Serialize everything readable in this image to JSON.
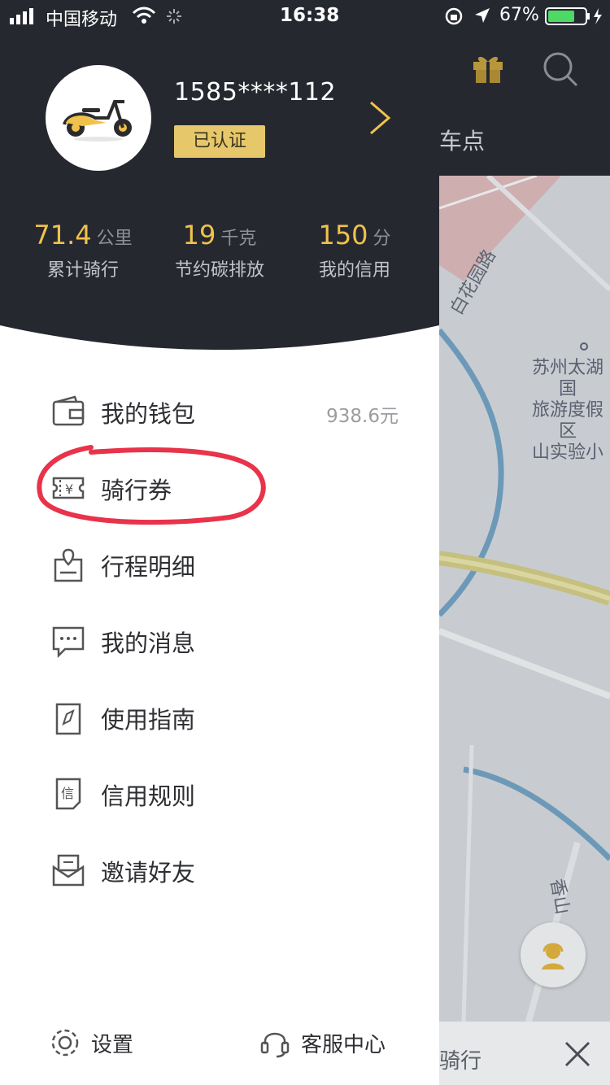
{
  "status_bar": {
    "carrier": "中国移动",
    "time": "16:38",
    "battery": "67%"
  },
  "map": {
    "top_label": "车点",
    "poi": [
      "苏州太湖国",
      "旅游度假区",
      "山实验小"
    ],
    "road_label_1": "白花园路",
    "road_label_2": "香山",
    "bottom_text": "骑行"
  },
  "profile": {
    "phone": "1585****112",
    "badge": "已认证"
  },
  "stats": [
    {
      "value": "71.4",
      "unit": "公里",
      "label": "累计骑行"
    },
    {
      "value": "19",
      "unit": "千克",
      "label": "节约碳排放"
    },
    {
      "value": "150",
      "unit": "分",
      "label": "我的信用"
    }
  ],
  "menu": [
    {
      "label": "我的钱包",
      "value": "938.6元",
      "icon": "wallet-icon"
    },
    {
      "label": "骑行券",
      "value": "",
      "icon": "coupon-icon"
    },
    {
      "label": "行程明细",
      "value": "",
      "icon": "trip-location-icon"
    },
    {
      "label": "我的消息",
      "value": "",
      "icon": "message-icon"
    },
    {
      "label": "使用指南",
      "value": "",
      "icon": "guide-compass-icon"
    },
    {
      "label": "信用规则",
      "value": "",
      "icon": "credit-rules-icon"
    },
    {
      "label": "邀请好友",
      "value": "",
      "icon": "invite-envelope-icon"
    }
  ],
  "footer": {
    "settings": "设置",
    "customer_service": "客服中心"
  },
  "colors": {
    "header_bg": "#262830",
    "accent_yellow": "#f1c24b",
    "badge_bg": "#e6c86b",
    "annotation_red": "#e8334a"
  }
}
